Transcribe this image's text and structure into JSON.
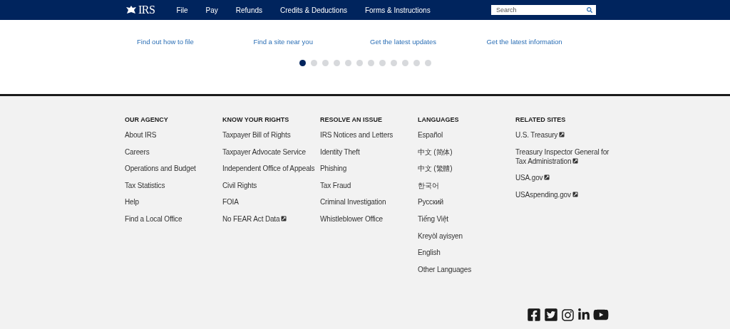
{
  "header": {
    "logo": "IRS",
    "nav": [
      "File",
      "Pay",
      "Refunds",
      "Credits & Deductions",
      "Forms & Instructions"
    ],
    "search": {
      "placeholder": "Search"
    }
  },
  "quick_links": [
    "Find out how to file",
    "Find a site near you",
    "Get the latest updates",
    "Get the latest information"
  ],
  "carousel_dots": [
    {
      "selected": true
    },
    {
      "selected": false
    },
    {
      "selected": false
    },
    {
      "selected": false
    },
    {
      "selected": false
    },
    {
      "selected": false
    },
    {
      "selected": false
    },
    {
      "selected": false
    },
    {
      "selected": false
    },
    {
      "selected": false
    },
    {
      "selected": false
    },
    {
      "selected": false
    }
  ],
  "footer_columns": [
    {
      "heading": "OUR AGENCY",
      "links": [
        {
          "text": "About IRS",
          "external": false
        },
        {
          "text": "Careers",
          "external": false
        },
        {
          "text": "Operations and Budget",
          "external": false
        },
        {
          "text": "Tax Statistics",
          "external": false
        },
        {
          "text": "Help",
          "external": false
        },
        {
          "text": "Find a Local Office",
          "external": false
        }
      ]
    },
    {
      "heading": "KNOW YOUR RIGHTS",
      "links": [
        {
          "text": "Taxpayer Bill of Rights",
          "external": false
        },
        {
          "text": "Taxpayer Advocate Service",
          "external": false
        },
        {
          "text": "Independent Office of Appeals",
          "external": false
        },
        {
          "text": "Civil Rights",
          "external": false
        },
        {
          "text": "FOIA",
          "external": false
        },
        {
          "text": "No FEAR Act Data",
          "external": true
        }
      ]
    },
    {
      "heading": "RESOLVE AN ISSUE",
      "links": [
        {
          "text": "IRS Notices and Letters",
          "external": false
        },
        {
          "text": "Identity Theft",
          "external": false
        },
        {
          "text": "Phishing",
          "external": false
        },
        {
          "text": "Tax Fraud",
          "external": false
        },
        {
          "text": "Criminal Investigation",
          "external": false
        },
        {
          "text": "Whistleblower Office",
          "external": false
        }
      ]
    },
    {
      "heading": "LANGUAGES",
      "links": [
        {
          "text": "Español",
          "external": false
        },
        {
          "text": "中文 (简体)",
          "external": false
        },
        {
          "text": "中文 (繁體)",
          "external": false
        },
        {
          "text": "한국어",
          "external": false
        },
        {
          "text": "Русский",
          "external": false
        },
        {
          "text": "Tiếng Việt",
          "external": false
        },
        {
          "text": "Kreyòl ayisyen",
          "external": false
        },
        {
          "text": "English",
          "external": false
        },
        {
          "text": "Other Languages",
          "external": false
        }
      ]
    },
    {
      "heading": "RELATED SITES",
      "links": [
        {
          "text": "U.S. Treasury",
          "external": true
        },
        {
          "text": "Treasury Inspector General for Tax Administration",
          "external": true
        },
        {
          "text": "USA.gov",
          "external": true
        },
        {
          "text": "USAspending.gov",
          "external": true
        }
      ]
    }
  ]
}
